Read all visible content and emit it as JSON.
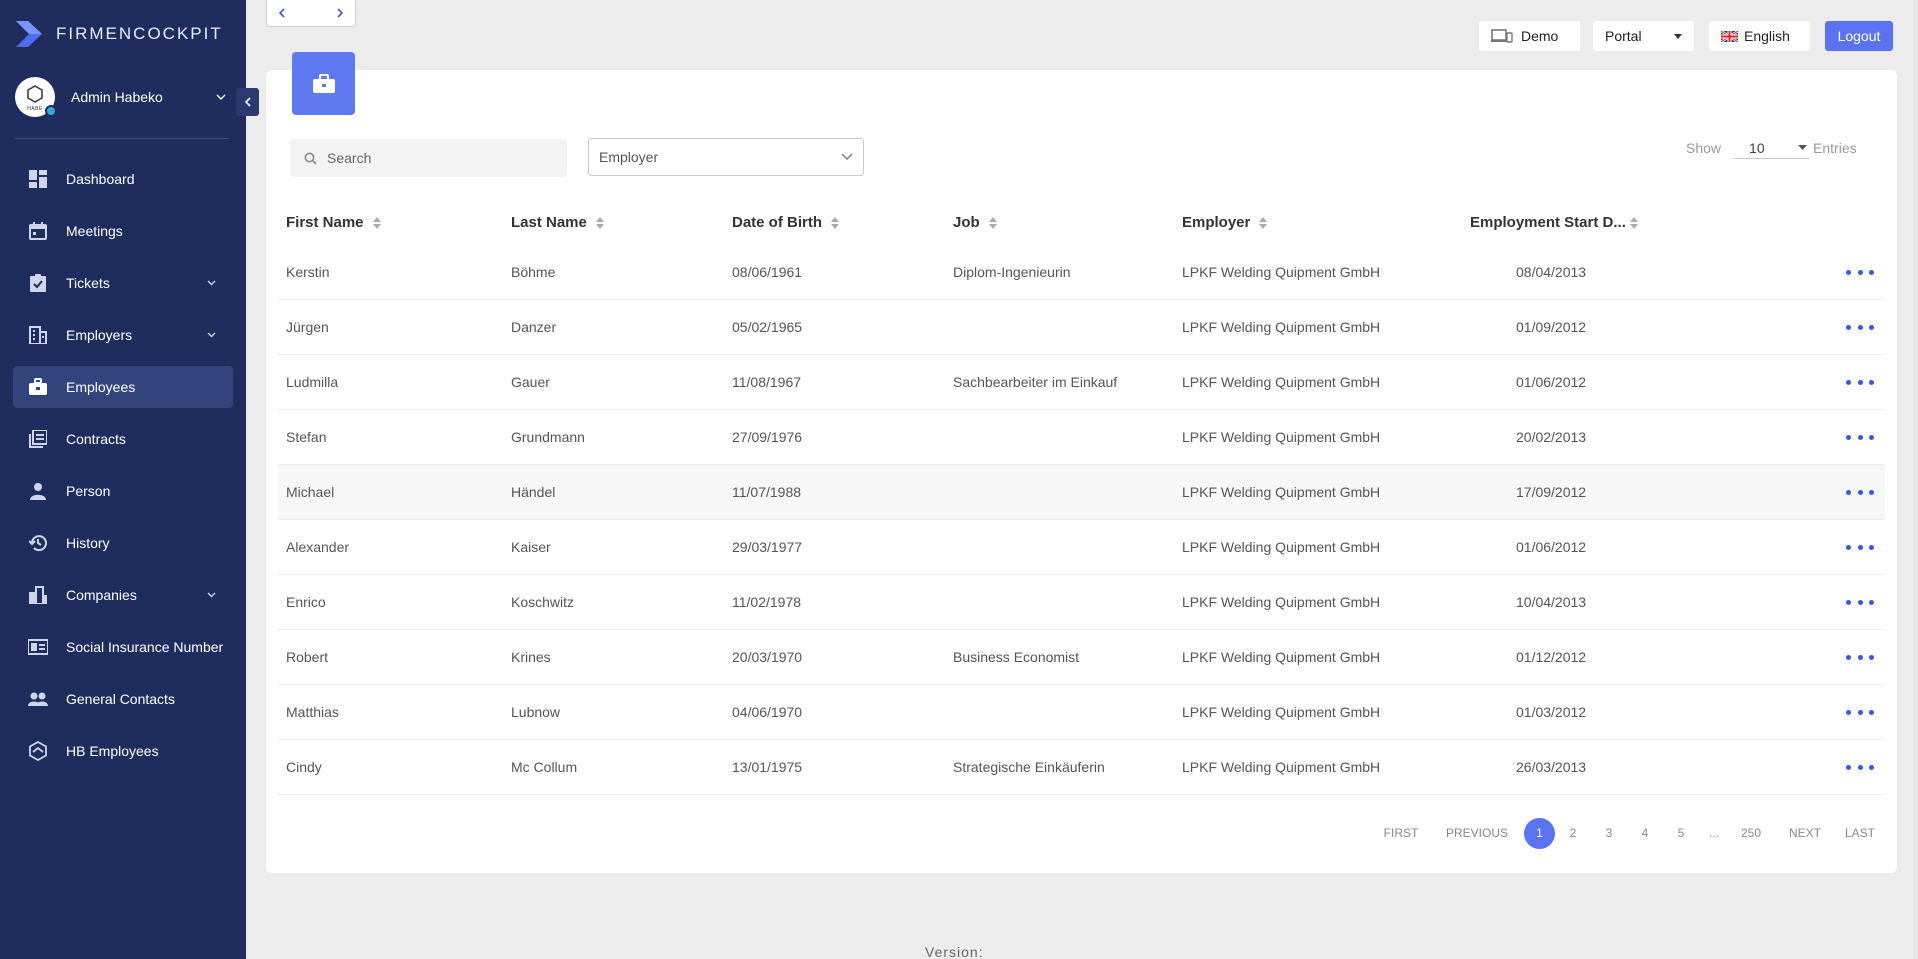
{
  "brand": {
    "name": "FIRMENCOCKPIT"
  },
  "user": {
    "name": "Admin Habeko",
    "avatar_text": "HABE"
  },
  "sidebar": {
    "items": [
      {
        "label": "Dashboard",
        "icon": "dashboard-icon",
        "expandable": false
      },
      {
        "label": "Meetings",
        "icon": "calendar-icon",
        "expandable": false
      },
      {
        "label": "Tickets",
        "icon": "ticket-check-icon",
        "expandable": true
      },
      {
        "label": "Employers",
        "icon": "building-icon",
        "expandable": true
      },
      {
        "label": "Employees",
        "icon": "briefcase-icon",
        "expandable": false,
        "active": true
      },
      {
        "label": "Contracts",
        "icon": "contracts-icon",
        "expandable": false
      },
      {
        "label": "Person",
        "icon": "person-icon",
        "expandable": false
      },
      {
        "label": "History",
        "icon": "history-icon",
        "expandable": false
      },
      {
        "label": "Companies",
        "icon": "companies-icon",
        "expandable": true
      },
      {
        "label": "Social Insurance Number",
        "icon": "id-card-icon",
        "expandable": false
      },
      {
        "label": "General Contacts",
        "icon": "contacts-icon",
        "expandable": false
      },
      {
        "label": "HB Employees",
        "icon": "hexagon-icon",
        "expandable": false
      }
    ]
  },
  "topbar": {
    "demo_label": "Demo",
    "portal_label": "Portal",
    "language_label": "English",
    "logout_label": "Logout"
  },
  "filters": {
    "search_placeholder": "Search",
    "employer_placeholder": "Employer",
    "show_label": "Show",
    "entries_value": "10",
    "entries_label": "Entries"
  },
  "table": {
    "columns": [
      "First Name",
      "Last Name",
      "Date of Birth",
      "Job",
      "Employer",
      "Employment Start D..."
    ],
    "rows": [
      [
        "Kerstin",
        "Böhme",
        "08/06/1961",
        "Diplom-Ingenieurin",
        "LPKF Welding Quipment GmbH",
        "08/04/2013"
      ],
      [
        "Jürgen",
        "Danzer",
        "05/02/1965",
        "",
        "LPKF Welding Quipment GmbH",
        "01/09/2012"
      ],
      [
        "Ludmilla",
        "Gauer",
        "11/08/1967",
        "Sachbearbeiter im Einkauf",
        "LPKF Welding Quipment GmbH",
        "01/06/2012"
      ],
      [
        "Stefan",
        "Grundmann",
        "27/09/1976",
        "",
        "LPKF Welding Quipment GmbH",
        "20/02/2013"
      ],
      [
        "Michael",
        "Händel",
        "11/07/1988",
        "",
        "LPKF Welding Quipment GmbH",
        "17/09/2012"
      ],
      [
        "Alexander",
        "Kaiser",
        "29/03/1977",
        "",
        "LPKF Welding Quipment GmbH",
        "01/06/2012"
      ],
      [
        "Enrico",
        "Koschwitz",
        "11/02/1978",
        "",
        "LPKF Welding Quipment GmbH",
        "10/04/2013"
      ],
      [
        "Robert",
        "Krines",
        "20/03/1970",
        "Business Economist",
        "LPKF Welding Quipment GmbH",
        "01/12/2012"
      ],
      [
        "Matthias",
        "Lubnow",
        "04/06/1970",
        "",
        "LPKF Welding Quipment GmbH",
        "01/03/2012"
      ],
      [
        "Cindy",
        "Mc Collum",
        "13/01/1975",
        "Strategische Einkäuferin",
        "LPKF Welding Quipment GmbH",
        "26/03/2013"
      ]
    ]
  },
  "pagination": {
    "first": "FIRST",
    "previous": "PREVIOUS",
    "pages": [
      "1",
      "2",
      "3",
      "4",
      "5",
      "...",
      "250"
    ],
    "current": "1",
    "next": "NEXT",
    "last": "LAST"
  },
  "footer": {
    "version_label": "Version:"
  },
  "colors": {
    "sidebar": "#1f2d5e",
    "accent": "#5b73f0",
    "dots": "#3b56d9"
  }
}
